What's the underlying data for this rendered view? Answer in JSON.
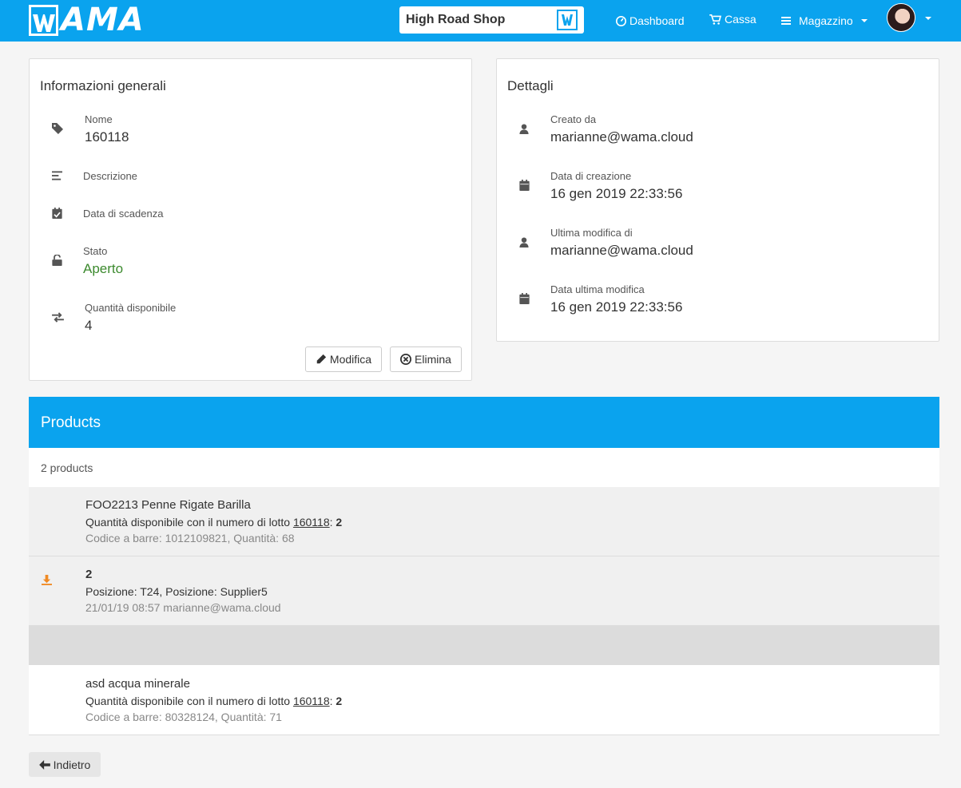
{
  "navbar": {
    "logo_text": "AMA",
    "logo_mark": "W",
    "shop": "High Road Shop",
    "links": {
      "dashboard": "Dashboard",
      "cassa": "Cassa",
      "magazzino": "Magazzino"
    }
  },
  "general": {
    "title": "Informazioni generali",
    "nome_label": "Nome",
    "nome_value": "160118",
    "descrizione_label": "Descrizione",
    "scadenza_label": "Data di scadenza",
    "stato_label": "Stato",
    "stato_value": "Aperto",
    "quantita_label": "Quantità disponibile",
    "quantita_value": "4",
    "edit_label": "Modifica",
    "delete_label": "Elimina"
  },
  "details": {
    "title": "Dettagli",
    "creato_label": "Creato da",
    "creato_value": "marianne@wama.cloud",
    "creazione_label": "Data di creazione",
    "creazione_value": "16 gen 2019 22:33:56",
    "modifica_label": "Ultima modifica di",
    "modifica_value": "marianne@wama.cloud",
    "ultima_label": "Data ultima modifica",
    "ultima_value": "16 gen 2019 22:33:56"
  },
  "products": {
    "title": "Products",
    "count": "2 products",
    "items": [
      {
        "name": "FOO2213 Penne Rigate Barilla",
        "qty_prefix": "Quantità disponibile con il numero di lotto",
        "lot": "160118",
        "sep": ":",
        "qty": "2",
        "barcode": "Codice a barre: 1012109821, Quantità: 68"
      },
      {
        "movement_qty": "2",
        "position": "Posizione: T24, Posizione: Supplier5",
        "meta": "21/01/19 08:57 marianne@wama.cloud"
      },
      {
        "name": "asd acqua minerale",
        "qty_prefix": "Quantità disponibile con il numero di lotto",
        "lot": "160118",
        "sep": ":",
        "qty": "2",
        "barcode": "Codice a barre: 80328124, Quantità: 71"
      }
    ]
  },
  "back_label": "Indietro",
  "colors": {
    "primary": "#0aa3ee",
    "status_open": "#3c8a2e",
    "movement_icon": "#f08a24"
  },
  "icons": [
    "tag-icon",
    "align-left-icon",
    "calendar-check-icon",
    "unlock-icon",
    "exchange-icon",
    "user-icon",
    "calendar-icon",
    "pencil-icon",
    "times-circle-icon",
    "arrow-left-icon",
    "tachometer-icon",
    "cart-icon",
    "bars-icon",
    "download-icon"
  ]
}
